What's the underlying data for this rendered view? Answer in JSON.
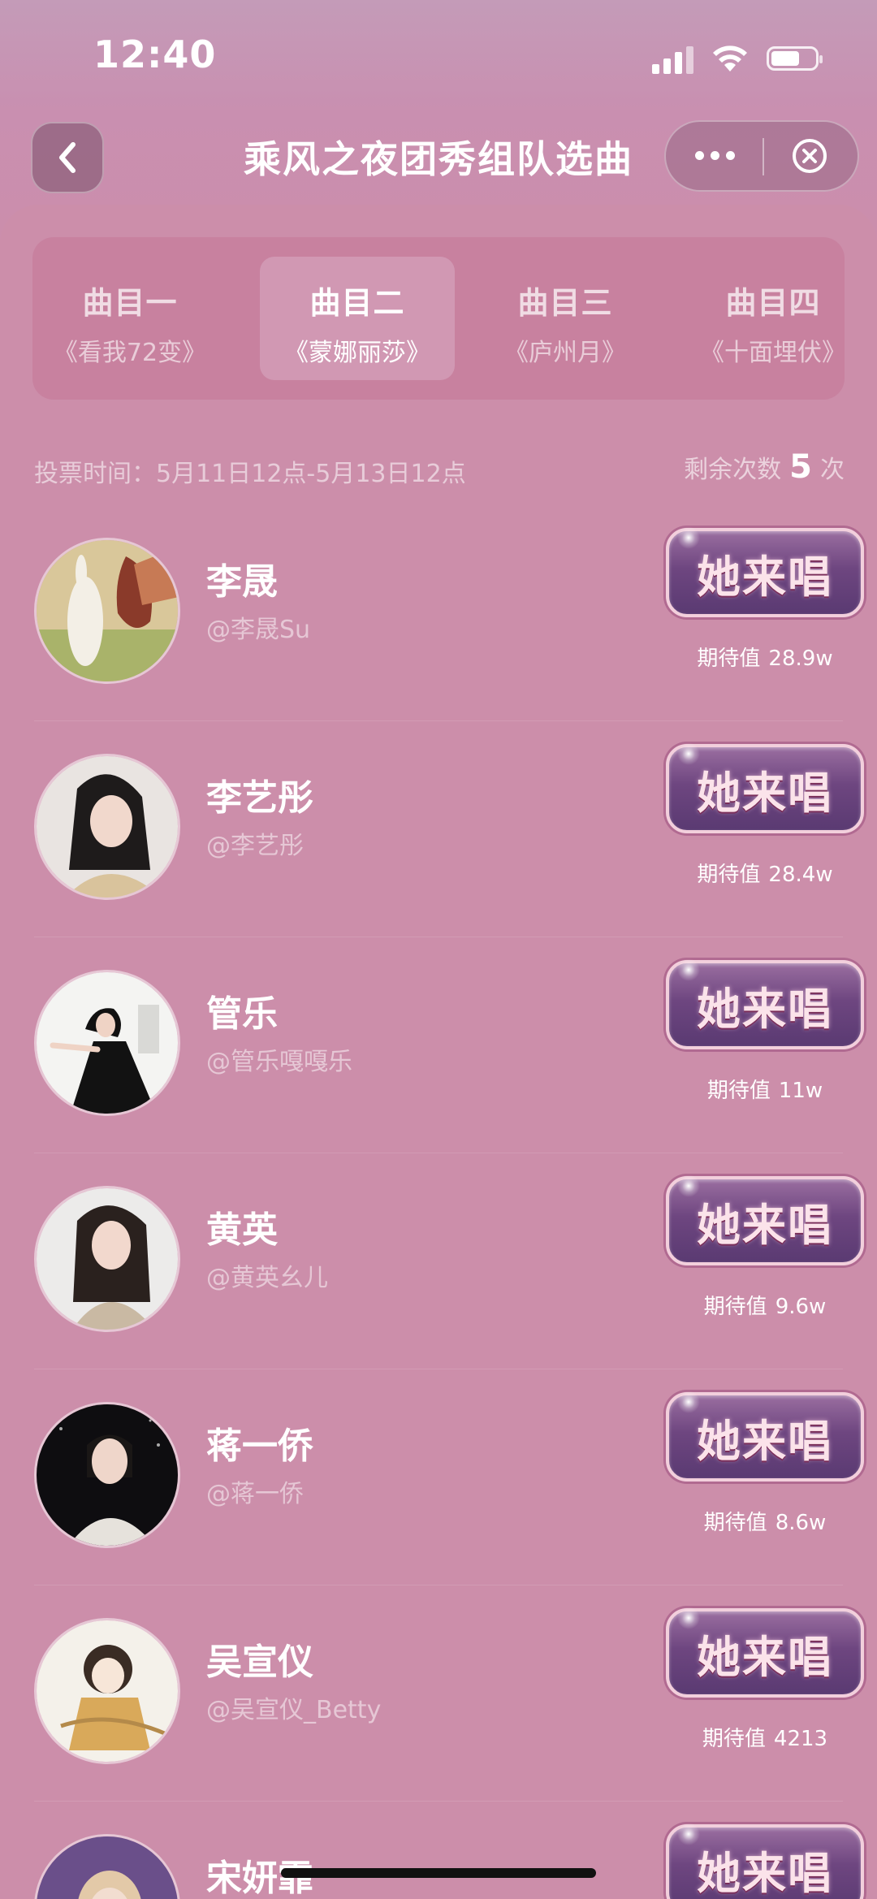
{
  "status_bar": {
    "time": "12:40",
    "battery_level": 0.65
  },
  "nav": {
    "title": "乘风之夜团秀组队选曲",
    "back_icon": "chevron-left-icon",
    "more_icon": "more-dots-icon",
    "close_icon": "close-circle-icon"
  },
  "tabs": [
    {
      "name": "曲目一",
      "song": "《看我72变》",
      "active": false
    },
    {
      "name": "曲目二",
      "song": "《蒙娜丽莎》",
      "active": true
    },
    {
      "name": "曲目三",
      "song": "《庐州月》",
      "active": false
    },
    {
      "name": "曲目四",
      "song": "《十面埋伏》",
      "active": false
    }
  ],
  "vote": {
    "time_text": "投票时间：5月11日12点-5月13日12点",
    "remaining_label": "剩余次数",
    "remaining_count": "5",
    "remaining_unit": "次"
  },
  "sing_label": "她来唱",
  "expect_label": "期待值",
  "candidates": [
    {
      "name": "李晟",
      "handle": "@李晟Su",
      "expect": "28.9w"
    },
    {
      "name": "李艺彤",
      "handle": "@李艺彤",
      "expect": "28.4w"
    },
    {
      "name": "管乐",
      "handle": "@管乐嘎嘎乐",
      "expect": "11w"
    },
    {
      "name": "黄英",
      "handle": "@黄英幺儿",
      "expect": "9.6w"
    },
    {
      "name": "蒋一侨",
      "handle": "@蒋一侨",
      "expect": "8.6w"
    },
    {
      "name": "吴宣仪",
      "handle": "@吴宣仪_Betty",
      "expect": "4213"
    },
    {
      "name": "宋妍霏",
      "handle": "",
      "expect": ""
    }
  ]
}
